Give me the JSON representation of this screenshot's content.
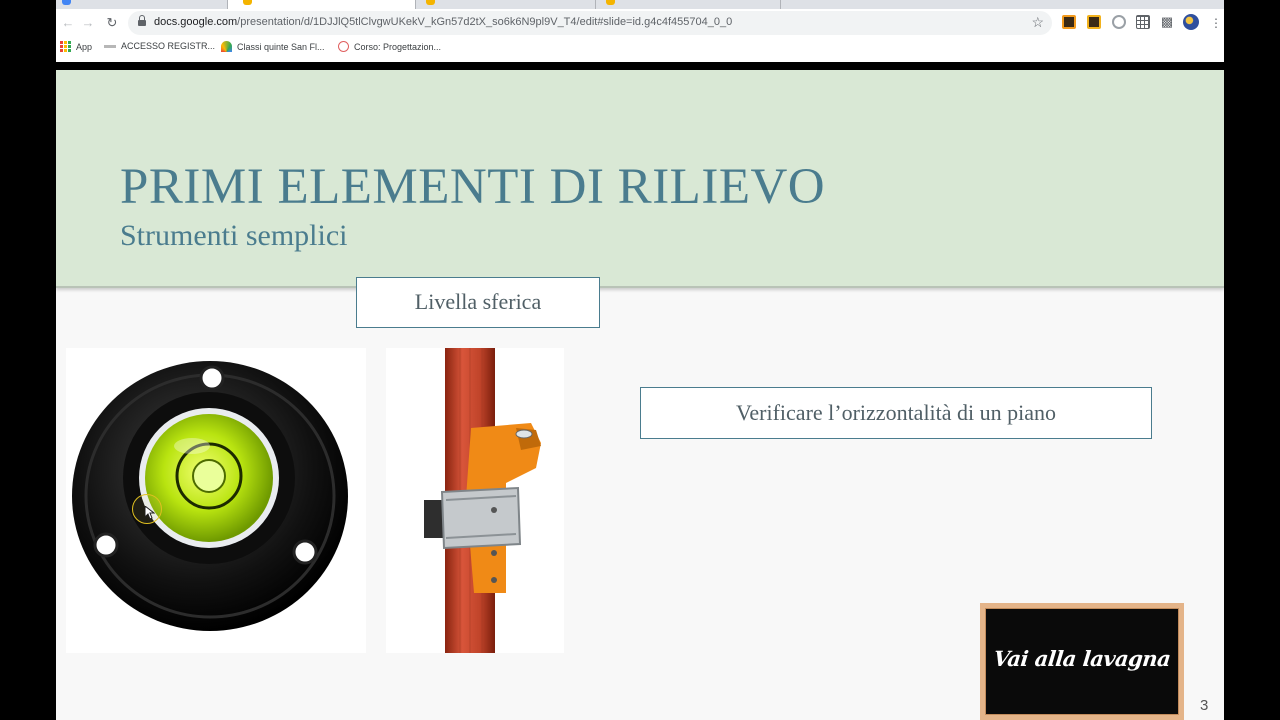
{
  "browser": {
    "url_host": "docs.google.com",
    "url_path": "/presentation/d/1DJJlQ5tlClvgwUKekV_kGn57d2tX_so6k6N9pl9V_T4/edit#slide=id.g4c4f455704_0_0",
    "bookmarks": [
      {
        "label": "App",
        "icon": "apps-grid-icon"
      },
      {
        "label": "ACCESSO REGISTR...",
        "icon": "registry-icon"
      },
      {
        "label": "Classi quinte San Fl...",
        "icon": "rainbow-icon"
      },
      {
        "label": "Corso: Progettazion...",
        "icon": "course-icon"
      }
    ],
    "extensions": [
      "ext-orange-icon",
      "ext-orange-check-icon",
      "ext-circle-icon",
      "ext-grid-icon",
      "puzzle-icon",
      "profile-avatar-icon"
    ]
  },
  "slide": {
    "title": "PRIMI ELEMENTI DI RILIEVO",
    "subtitle": "Strumenti semplici",
    "caption_livella": "Livella sferica",
    "caption_verificare": "Verificare l’orizzontalità di un piano",
    "board_button_label": "Vai alla lavagna",
    "slide_number": "3"
  },
  "colors": {
    "title": "#4a7c8e",
    "header_bg": "#d9e8d5",
    "slide_bg": "#f8f8f8",
    "board_frame": "#e4b489"
  }
}
